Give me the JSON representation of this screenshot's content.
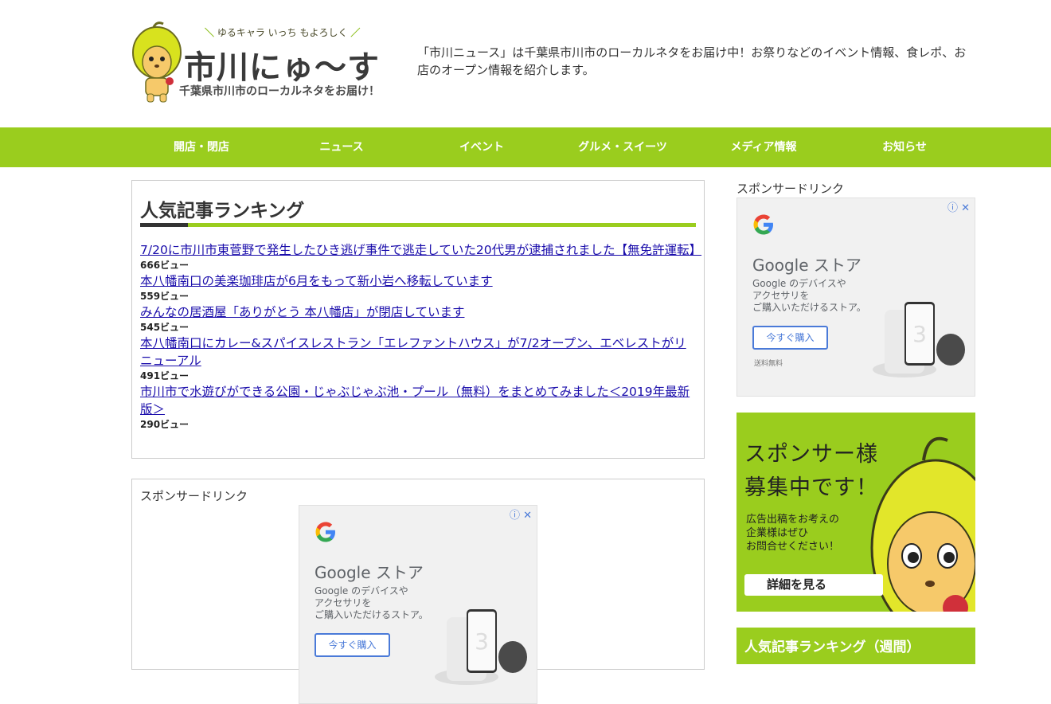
{
  "header": {
    "tagline": "ゆるキャラ いっち もよろしく",
    "site_title": "市川にゅ～す",
    "logo_subtitle": "千葉県市川市のローカルネタをお届け！",
    "description": "「市川ニュース」は千葉県市川市のローカルネタをお届け中！お祭りなどのイベント情報、食レポ、お店のオープン情報を紹介します。"
  },
  "nav": {
    "items": [
      {
        "label": "開店・閉店"
      },
      {
        "label": "ニュース"
      },
      {
        "label": "イベント"
      },
      {
        "label": "グルメ・スイーツ"
      },
      {
        "label": "メディア情報"
      },
      {
        "label": "お知らせ"
      }
    ]
  },
  "ranking": {
    "title": "人気記事ランキング",
    "items": [
      {
        "title": "7/20に市川市東菅野で発生したひき逃げ事件で逃走していた20代男が逮捕されました【無免許運転】",
        "views": "666ビュー"
      },
      {
        "title": "本八幡南口の美楽珈琲店が6月をもって新小岩へ移転しています",
        "views": "559ビュー"
      },
      {
        "title": "みんなの居酒屋「ありがとう 本八幡店」が閉店しています",
        "views": "545ビュー"
      },
      {
        "title": "本八幡南口にカレー&スパイスレストラン「エレファントハウス」が7/2オープン、エベレストがリニューアル",
        "views": "491ビュー"
      },
      {
        "title": "市川市で水遊びができる公園・じゃぶじゃぶ池・プール（無料）をまとめてみました＜2019年最新版＞",
        "views": "290ビュー"
      }
    ]
  },
  "sponsor": {
    "label": "スポンサードリンク"
  },
  "ad": {
    "title": "Google ストア",
    "text": "Google のデバイスや\nアクセサリを\nご購入いただけるストア。",
    "button": "今すぐ購入",
    "shipping": "送料無料",
    "close": "ⓘ ✕"
  },
  "sidebar": {
    "sponsor_label": "スポンサードリンク",
    "banner": {
      "line1": "スポンサー様",
      "line2": "募集中です！",
      "small": "広告出稿をお考えの\n企業様はぜひ\nお問合せください！",
      "button": "詳細を見る"
    },
    "weekly_title": "人気記事ランキング（週間）"
  },
  "colors": {
    "accent": "#9acd1e",
    "link": "#1a0dab"
  }
}
